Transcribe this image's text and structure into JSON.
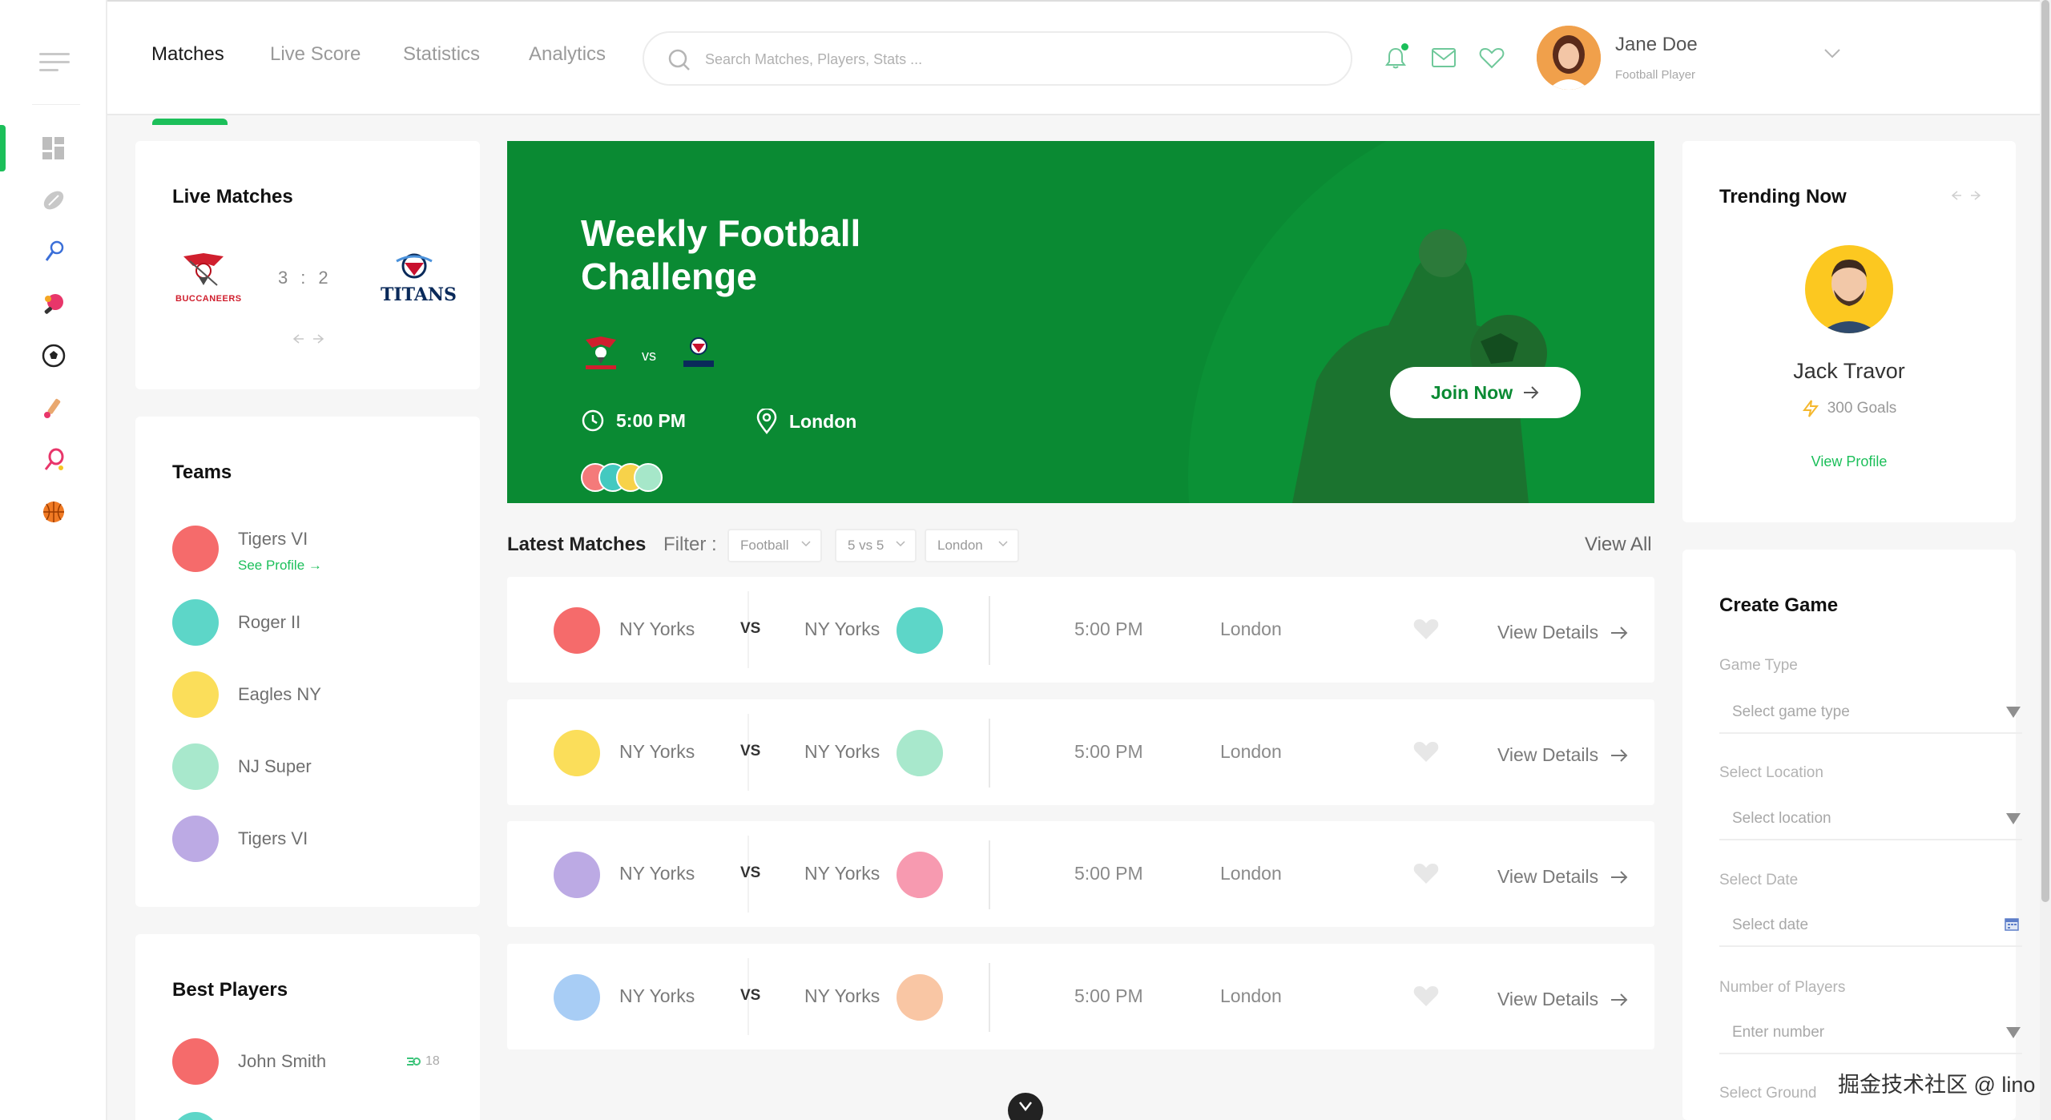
{
  "header": {
    "tabs": [
      {
        "label": "Matches"
      },
      {
        "label": "Live Score"
      },
      {
        "label": "Statistics"
      },
      {
        "label": "Analytics"
      }
    ],
    "search_placeholder": "Search Matches, Players, Stats ...",
    "user": {
      "name": "Jane Doe",
      "role": "Football Player"
    }
  },
  "sidebar": {
    "icons": [
      "dashboard-icon",
      "football-icon",
      "badminton-icon",
      "table-tennis-icon",
      "soccer-ball-icon",
      "cricket-icon",
      "tennis-racket-icon",
      "basketball-icon"
    ]
  },
  "live_matches": {
    "title": "Live Matches",
    "home_team": "BUCCANEERS",
    "away_team": "TITANS",
    "home_score": "3",
    "separator": ":",
    "away_score": "2"
  },
  "teams": {
    "title": "Teams",
    "items": [
      {
        "name": "Tigers VI",
        "color": "#f56b6b",
        "link": "See Profile"
      },
      {
        "name": "Roger II",
        "color": "#5dd6c8"
      },
      {
        "name": "Eagles NY",
        "color": "#fbde5a"
      },
      {
        "name": "NJ Super",
        "color": "#a8e8cc"
      },
      {
        "name": "Tigers VI",
        "color": "#bcaae4"
      }
    ]
  },
  "best_players": {
    "title": "Best Players",
    "items": [
      {
        "name": "John Smith",
        "value": "18",
        "color": "#f56b6b"
      }
    ]
  },
  "hero": {
    "title": "Weekly Football Challenge",
    "vs": "vs",
    "time": "5:00 PM",
    "location": "London",
    "cta": "Join Now",
    "avatar_colors": [
      "#f47a7a",
      "#43c9c0",
      "#f7d24a",
      "#a6e7c9"
    ],
    "bg_color": "#0a8a33"
  },
  "latest_matches": {
    "title": "Latest Matches",
    "filter_label": "Filter :",
    "filters": [
      "Football",
      "5 vs 5",
      "London"
    ],
    "view_all": "View All",
    "rows": [
      {
        "home": "NY Yorks",
        "away": "NY Yorks",
        "vs": "VS",
        "time": "5:00 PM",
        "location": "London",
        "cta": "View Details",
        "home_color": "#f56b6b",
        "away_color": "#5dd6c8"
      },
      {
        "home": "NY Yorks",
        "away": "NY Yorks",
        "vs": "VS",
        "time": "5:00 PM",
        "location": "London",
        "cta": "View Details",
        "home_color": "#fbde5a",
        "away_color": "#a8e8cc"
      },
      {
        "home": "NY Yorks",
        "away": "NY Yorks",
        "vs": "VS",
        "time": "5:00 PM",
        "location": "London",
        "cta": "View Details",
        "home_color": "#bcaae4",
        "away_color": "#f79ab0"
      },
      {
        "home": "NY Yorks",
        "away": "NY Yorks",
        "vs": "VS",
        "time": "5:00 PM",
        "location": "London",
        "cta": "View Details",
        "home_color": "#a8cdf5",
        "away_color": "#f9c6a4"
      }
    ]
  },
  "trending": {
    "title": "Trending Now",
    "player": "Jack Travor",
    "goals": "300 Goals",
    "link": "View Profile"
  },
  "create_game": {
    "title": "Create Game",
    "fields": [
      {
        "label": "Game Type",
        "placeholder": "Select game type"
      },
      {
        "label": "Select Location",
        "placeholder": "Select location"
      },
      {
        "label": "Select Date",
        "placeholder": "Select date"
      },
      {
        "label": "Number of Players",
        "placeholder": "Enter number"
      },
      {
        "label": "Select Ground"
      }
    ]
  },
  "watermark": "掘金技术社区 @ lino",
  "colors": {
    "accent": "#1cbf5a",
    "hero": "#0a8a33"
  }
}
